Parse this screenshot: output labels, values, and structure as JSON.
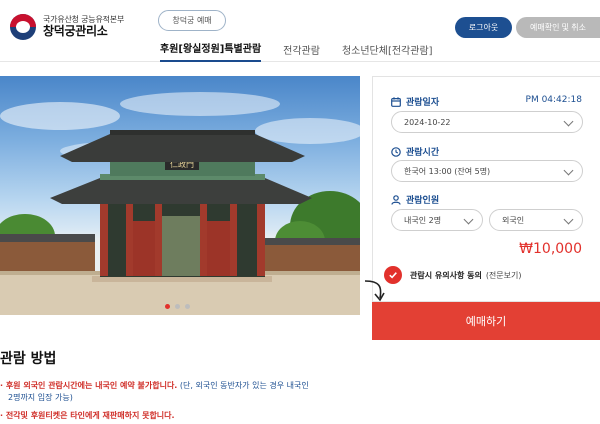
{
  "header": {
    "logo_sub": "국가유산청 궁능유적본부",
    "logo_title": "창덕궁관리소",
    "palace_pill": "창덕궁 예매",
    "login_label": "로그아웃",
    "check_label": "예매확인 및 취소"
  },
  "nav": {
    "tabs": [
      {
        "label": "후원[왕실정원]특별관람"
      },
      {
        "label": "전각관람"
      },
      {
        "label": "청소년단체[전각관람]"
      }
    ]
  },
  "hero": {
    "sign_text": "仁政門",
    "slides": 3,
    "active_slide": 1
  },
  "booking": {
    "date_label": "관람일자",
    "current_time": "PM 04:42:18",
    "date_value": "2024-10-22",
    "time_label": "관람시간",
    "time_value": "한국어 13:00 (잔여 5명)",
    "people_label": "관람인원",
    "domestic_value": "내국인 2명",
    "foreign_value": "외국인",
    "price": "₩10,000",
    "agree_text": "관람시 유의사항 동의",
    "agree_link": "(전문보기)",
    "reserve_label": "예매하기"
  },
  "guide": {
    "title": "관람 방법",
    "line1_red": "· 후원 외국인 관람시간에는 내국인 예약 불가합니다.",
    "line1_blue": "(단, 외국인 동반자가 있는 경우 내국인",
    "line1_cont": "2명까지 입장 가능)",
    "line2_red": "· 전각및 후원티켓은 타인에게 재판매하지 못합니다."
  },
  "colors": {
    "brand_blue": "#1d4f91",
    "accent_red": "#e34034",
    "disabled_gray": "#b9b9b9"
  }
}
